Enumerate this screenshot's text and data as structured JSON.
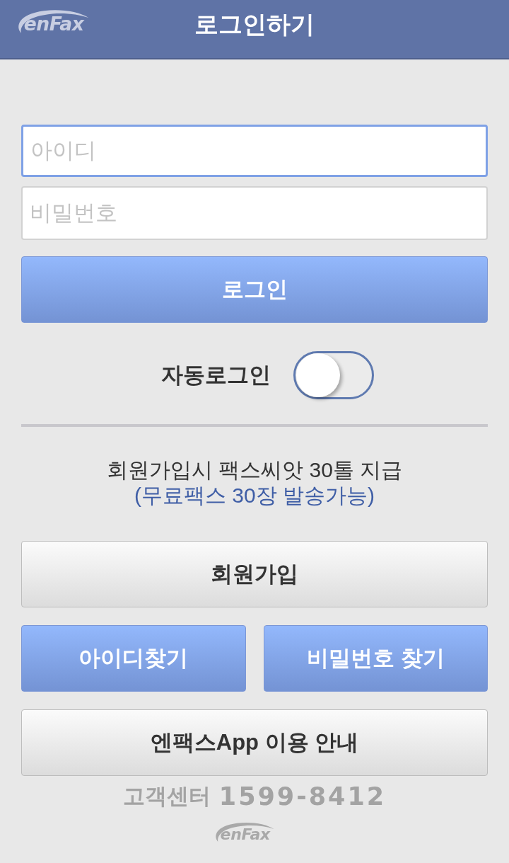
{
  "header": {
    "logo": "enFax",
    "title": "로그인하기"
  },
  "fields": [
    {
      "placeholder": "아이디",
      "focused": true
    },
    {
      "placeholder": "비밀번호",
      "focused": false
    }
  ],
  "login_button": {
    "label": "로그인",
    "kind": "primary"
  },
  "auto_login": {
    "label": "자동로그인",
    "on": false
  },
  "promo": {
    "line_1": "회원가입시 팩스씨앗 30톨 지급",
    "line_2": "(무료팩스 30장 발송가능)"
  },
  "signup_button": {
    "label": "회원가입",
    "kind": "secondary"
  },
  "find_buttons": [
    {
      "label": "아이디찾기",
      "kind": "primary"
    },
    {
      "label": "비밀번호 찾기",
      "kind": "primary"
    }
  ],
  "app_guide_button": {
    "label": "엔팩스App 이용 안내",
    "kind": "secondary"
  },
  "customer_center": {
    "label": "고객센터",
    "phone": "1599-8412"
  },
  "footer": {
    "logo": "enFax"
  }
}
